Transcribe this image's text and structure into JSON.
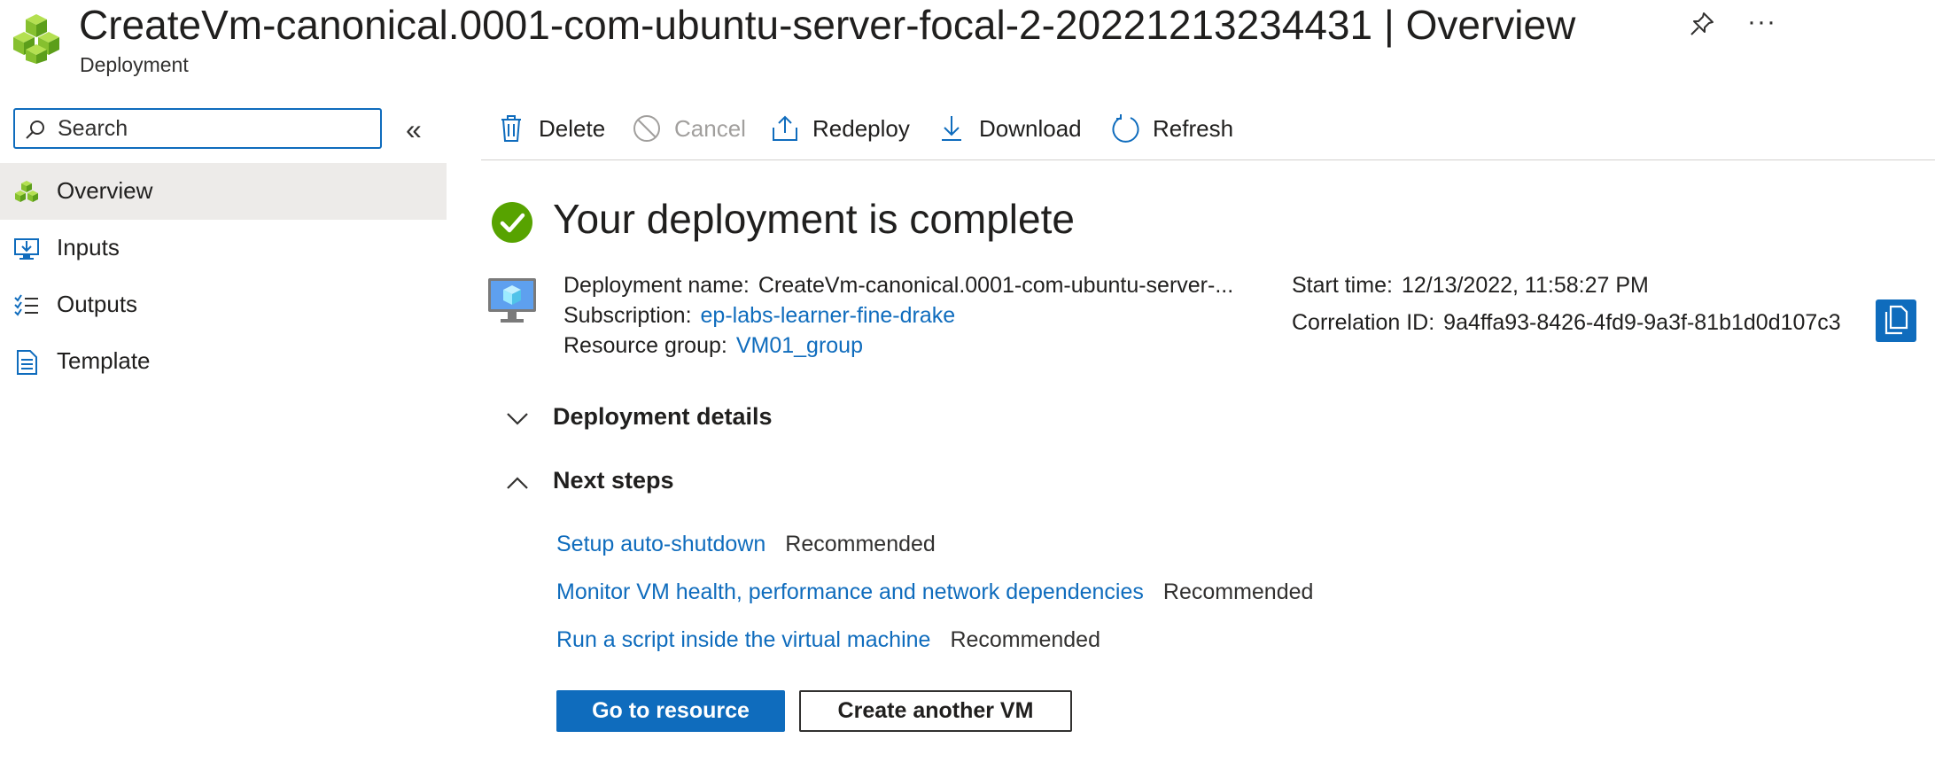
{
  "header": {
    "title_main": "CreateVm-canonical.0001-com-ubuntu-server-focal-2-20221213234431",
    "title_separator": " | ",
    "title_section": "Overview",
    "subtitle": "Deployment",
    "more_label": "···"
  },
  "sidebar": {
    "search_placeholder": "Search",
    "collapse_label": "«",
    "items": [
      {
        "label": "Overview",
        "icon": "cubes-icon",
        "selected": true
      },
      {
        "label": "Inputs",
        "icon": "inputs-icon",
        "selected": false
      },
      {
        "label": "Outputs",
        "icon": "outputs-icon",
        "selected": false
      },
      {
        "label": "Template",
        "icon": "template-icon",
        "selected": false
      }
    ]
  },
  "toolbar": {
    "delete_label": "Delete",
    "cancel_label": "Cancel",
    "redeploy_label": "Redeploy",
    "download_label": "Download",
    "refresh_label": "Refresh"
  },
  "main": {
    "status_title": "Your deployment is complete",
    "deployment_name_label": "Deployment name:",
    "deployment_name_value": "CreateVm-canonical.0001-com-ubuntu-server-...",
    "subscription_label": "Subscription:",
    "subscription_value": "ep-labs-learner-fine-drake",
    "resource_group_label": "Resource group:",
    "resource_group_value": "VM01_group",
    "start_time_label": "Start time:",
    "start_time_value": "12/13/2022, 11:58:27 PM",
    "correlation_id_label": "Correlation ID:",
    "correlation_id_value": "9a4ffa93-8426-4fd9-9a3f-81b1d0d107c3",
    "deployment_details_label": "Deployment details",
    "next_steps_label": "Next steps",
    "next_steps": [
      {
        "link": "Setup auto-shutdown",
        "tag": "Recommended"
      },
      {
        "link": "Monitor VM health, performance and network dependencies",
        "tag": "Recommended"
      },
      {
        "link": "Run a script inside the virtual machine",
        "tag": "Recommended"
      }
    ],
    "go_to_resource_label": "Go to resource",
    "create_another_label": "Create another VM"
  },
  "colors": {
    "accent": "#0f6cbd",
    "success": "#57a300",
    "selected_bg": "#edebe9"
  }
}
